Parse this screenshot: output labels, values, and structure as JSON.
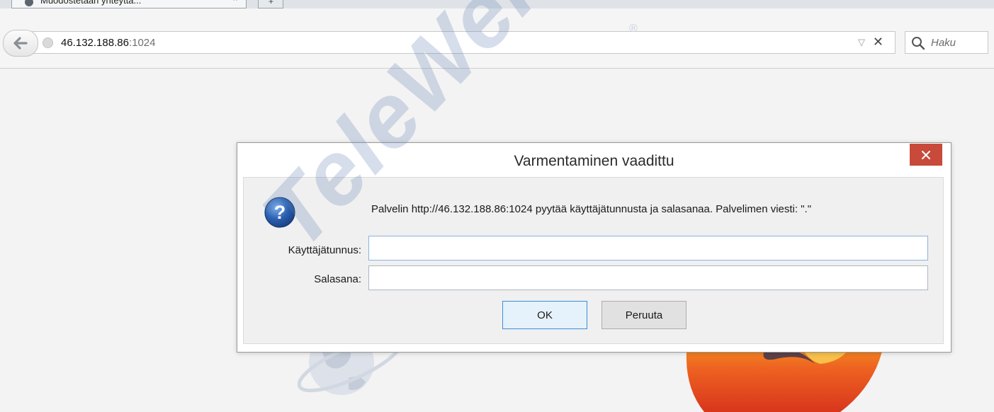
{
  "browser": {
    "tab": {
      "title": "Muodostetaan yhteyttä...",
      "close_symbol": "×"
    },
    "new_tab_symbol": "+",
    "address": {
      "host": "46.132.188.86",
      "port": ":1024"
    },
    "clear_symbol": "✕",
    "dropmarker_symbol": "▽",
    "search_placeholder": "Haku",
    "icons": [
      "back-arrow-icon",
      "globe-icon",
      "search-icon",
      "dropmarker-icon",
      "clear-icon"
    ]
  },
  "dialog": {
    "title": "Varmentaminen vaadittu",
    "close_symbol": "×",
    "message": "Palvelin http://46.132.188.86:1024 pyytää käyttäjätunnusta ja salasanaa. Palvelimen viesti: \".\"",
    "username_label": "Käyttäjätunnus:",
    "username_value": "",
    "password_label": "Salasana:",
    "password_value": "",
    "ok_label": "OK",
    "cancel_label": "Peruuta",
    "icon": "question-icon"
  },
  "watermark": {
    "text": "TeleWell",
    "registered_symbol": "®"
  },
  "colors": {
    "close_button": "#c74a3b",
    "ok_border": "#3c8ed6",
    "watermark": "#6080b2",
    "question_icon": "#2a5fb0"
  }
}
